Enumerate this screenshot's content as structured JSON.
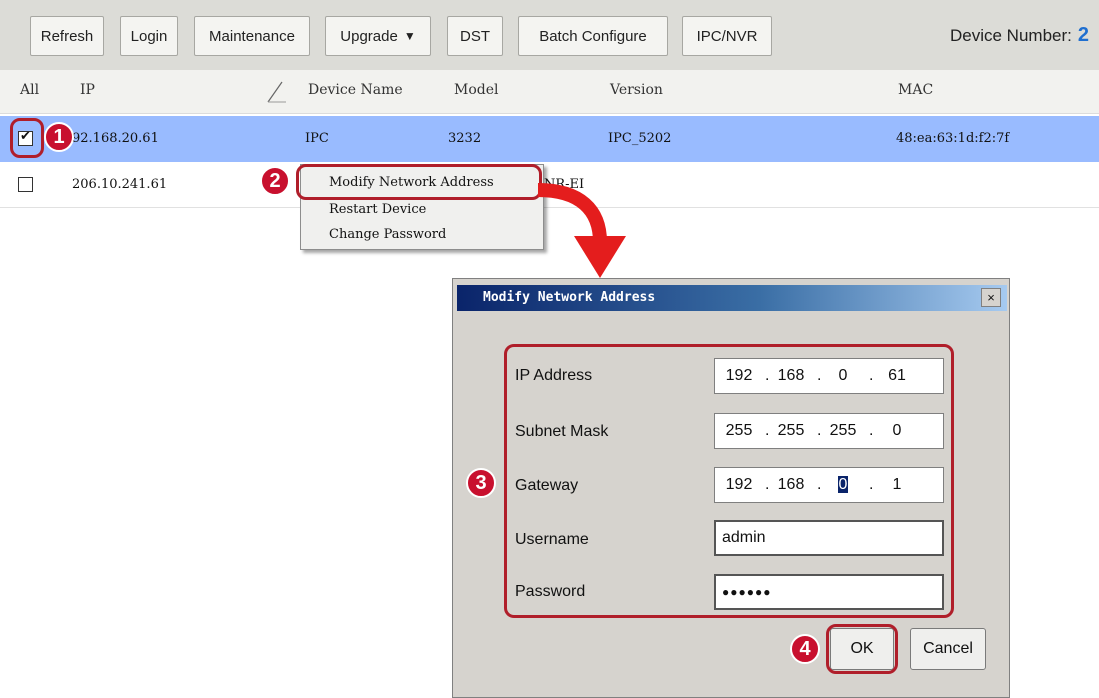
{
  "toolbar": {
    "buttons": [
      "Refresh",
      "Login",
      "Maintenance",
      "Upgrade",
      "DST",
      "Batch Configure",
      "IPC/NVR"
    ],
    "device_number_label": "Device Number:",
    "device_number_value": "2"
  },
  "table": {
    "headers": [
      "All",
      "IP",
      "Device Name",
      "Model",
      "Version",
      "MAC"
    ],
    "rows": [
      {
        "ip": "192.168.20.61",
        "ip_visible": "92.168.20.61",
        "name": "IPC",
        "model": "3232",
        "version": "IPC_5202",
        "mac": "48:ea:63:1d:f2:7f",
        "checked": true
      },
      {
        "ip": "206.10.241.61",
        "name": "",
        "model": "",
        "model_visible": "NR-EI",
        "version": "",
        "mac": "",
        "checked": false
      }
    ]
  },
  "context_menu": {
    "items": [
      "Modify Network Address",
      "Restart Device",
      "Change Password"
    ]
  },
  "callouts": [
    "1",
    "2",
    "3",
    "4"
  ],
  "dialog": {
    "title": "Modify Network Address",
    "close_glyph": "×",
    "labels": {
      "ip": "IP Address",
      "mask": "Subnet Mask",
      "gateway": "Gateway",
      "username": "Username",
      "password": "Password"
    },
    "ip": [
      "192",
      "168",
      "0",
      "61"
    ],
    "mask": [
      "255",
      "255",
      "255",
      "0"
    ],
    "gateway": [
      "192",
      "168",
      "0",
      "1"
    ],
    "username": "admin",
    "password": "●●●●●●",
    "ok": "OK",
    "cancel": "Cancel"
  },
  "colors": {
    "selected_row": "#99bbff",
    "callout": "#c8102e",
    "highlight": "#b01e2a",
    "device_number": "#1f6fd0"
  }
}
